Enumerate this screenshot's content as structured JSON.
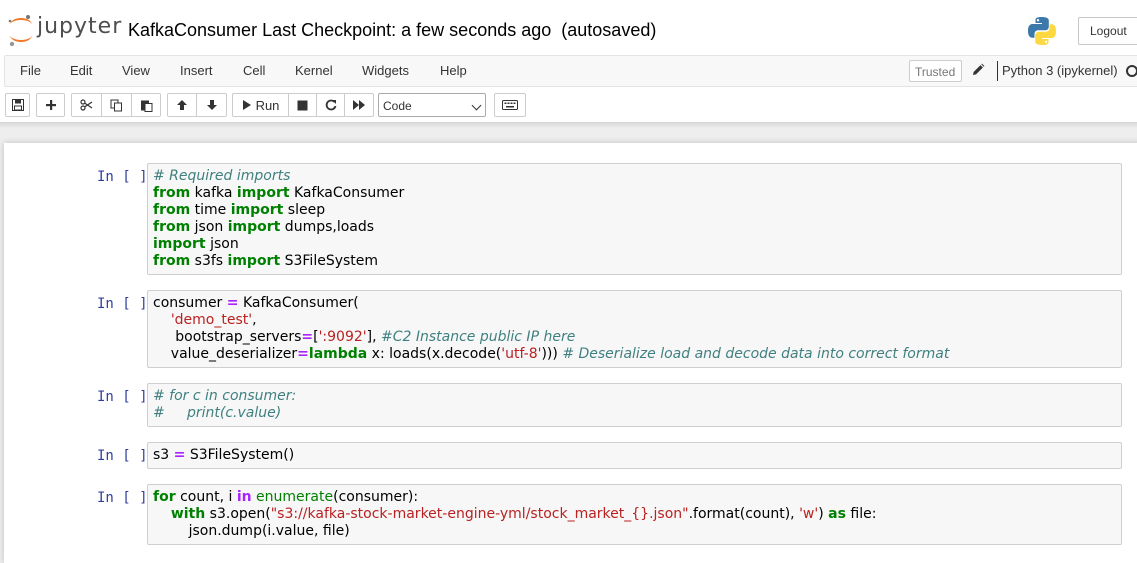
{
  "header": {
    "logo_text": "jupyter",
    "notebook_name": "KafkaConsumer",
    "checkpoint": "Last Checkpoint: a few seconds ago",
    "autosave": "(autosaved)",
    "logout_label": "Logout"
  },
  "menu": {
    "items": [
      "File",
      "Edit",
      "View",
      "Insert",
      "Cell",
      "Kernel",
      "Widgets",
      "Help"
    ],
    "trusted_label": "Trusted",
    "kernel_name": "Python 3 (ipykernel)"
  },
  "toolbar": {
    "run_label": "Run",
    "cell_type": "Code",
    "icons": [
      "save-icon",
      "plus-icon",
      "cut-icon",
      "copy-icon",
      "paste-icon",
      "arrow-up-icon",
      "arrow-down-icon",
      "play-icon",
      "stop-icon",
      "restart-icon",
      "fast-forward-icon",
      "keyboard-icon"
    ]
  },
  "cells": [
    {
      "prompt": "In [ ]:",
      "lines": [
        [
          [
            "cm",
            "# Required imports"
          ]
        ],
        [
          [
            "kw",
            "from"
          ],
          [
            "",
            " kafka "
          ],
          [
            "kw",
            "import"
          ],
          [
            "",
            " KafkaConsumer"
          ]
        ],
        [
          [
            "kw",
            "from"
          ],
          [
            "",
            " time "
          ],
          [
            "kw",
            "import"
          ],
          [
            "",
            " sleep"
          ]
        ],
        [
          [
            "kw",
            "from"
          ],
          [
            "",
            " json "
          ],
          [
            "kw",
            "import"
          ],
          [
            "",
            " dumps,loads"
          ]
        ],
        [
          [
            "kw",
            "import"
          ],
          [
            "",
            " json"
          ]
        ],
        [
          [
            "kw",
            "from"
          ],
          [
            "",
            " s3fs "
          ],
          [
            "kw",
            "import"
          ],
          [
            "",
            " S3FileSystem"
          ]
        ]
      ]
    },
    {
      "prompt": "In [ ]:",
      "lines": [
        [
          [
            "",
            "consumer "
          ],
          [
            "op",
            "="
          ],
          [
            "",
            " KafkaConsumer("
          ]
        ],
        [
          [
            "",
            "    "
          ],
          [
            "str",
            "'demo_test'"
          ],
          [
            "",
            ","
          ]
        ],
        [
          [
            "",
            "     bootstrap_servers"
          ],
          [
            "op",
            "="
          ],
          [
            "",
            "["
          ],
          [
            "str",
            "':9092'"
          ],
          [
            "",
            "], "
          ],
          [
            "cm",
            "#C2 Instance public IP here"
          ]
        ],
        [
          [
            "",
            "    value_deserializer"
          ],
          [
            "op",
            "="
          ],
          [
            "kw",
            "lambda"
          ],
          [
            "",
            " x: loads(x.decode("
          ],
          [
            "str",
            "'utf-8'"
          ],
          [
            "",
            "))) "
          ],
          [
            "cm",
            "# Deserialize load and decode data into correct format"
          ]
        ]
      ]
    },
    {
      "prompt": "In [ ]:",
      "lines": [
        [
          [
            "cm",
            "# for c in consumer:"
          ]
        ],
        [
          [
            "cm",
            "#     print(c.value)"
          ]
        ]
      ]
    },
    {
      "prompt": "In [ ]:",
      "lines": [
        [
          [
            "",
            "s3 "
          ],
          [
            "op",
            "="
          ],
          [
            "",
            " S3FileSystem()"
          ]
        ]
      ]
    },
    {
      "prompt": "In [ ]:",
      "lines": [
        [
          [
            "kw",
            "for"
          ],
          [
            "",
            " count, i "
          ],
          [
            "op",
            "in"
          ],
          [
            "",
            " "
          ],
          [
            "bi",
            "enumerate"
          ],
          [
            "",
            "(consumer):"
          ]
        ],
        [
          [
            "",
            "    "
          ],
          [
            "kw",
            "with"
          ],
          [
            "",
            " s3.open("
          ],
          [
            "str",
            "\"s3://kafka-stock-market-engine-yml/stock_market_{}.json\""
          ],
          [
            "",
            ".format(count), "
          ],
          [
            "str",
            "'w'"
          ],
          [
            "",
            ") "
          ],
          [
            "kw",
            "as"
          ],
          [
            "",
            " file:"
          ]
        ],
        [
          [
            "",
            "        json.dump(i.value, file)"
          ]
        ]
      ]
    }
  ]
}
